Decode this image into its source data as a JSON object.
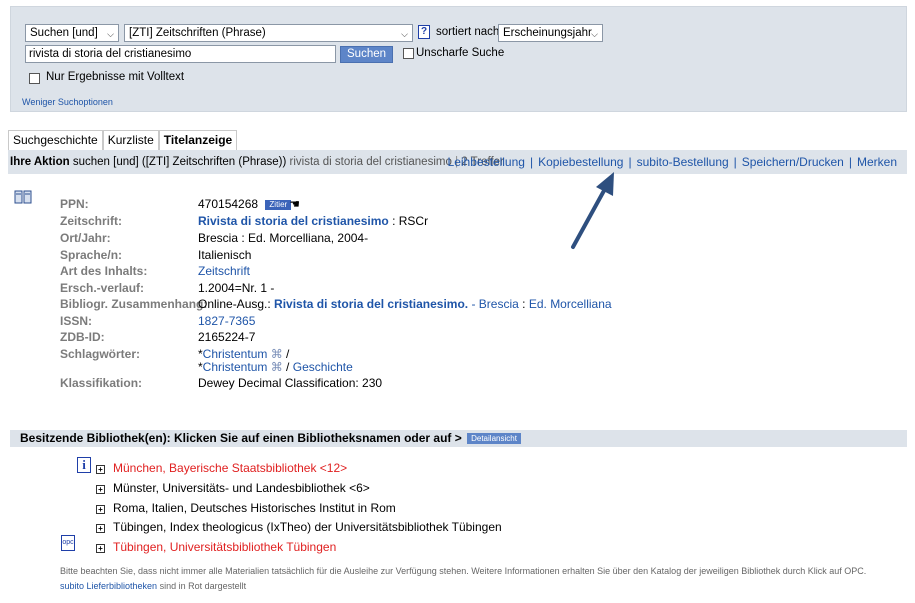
{
  "search": {
    "operator": "Suchen [und]",
    "field": "[ZTI] Zeitschriften (Phrase)",
    "help": "?",
    "sort_label": "sortiert nach",
    "sort_value": "Erscheinungsjahr",
    "query": "rivista di storia del cristianesimo",
    "submit": "Suchen",
    "fuzzy_label": "Unscharfe Suche",
    "fulltext_label": "Nur Ergebnisse mit Volltext",
    "fewer_options": "Weniger Suchoptionen"
  },
  "tabs": [
    {
      "label": "Suchgeschichte",
      "active": false
    },
    {
      "label": "Kurzliste",
      "active": false
    },
    {
      "label": "Titelanzeige",
      "active": true
    }
  ],
  "action_bar": {
    "title": "Ihre Aktion",
    "query_text": "suchen [und] ([ZTI] Zeitschriften (Phrase))",
    "query_value": "rivista di storia del cristianesimo",
    "hits": "2 Treffer",
    "links": [
      "Leihbestellung",
      "Kopiebestellung",
      "subito-Bestellung",
      "Speichern/Drucken",
      "Merken"
    ]
  },
  "record": {
    "ppn_label": "PPN:",
    "ppn": "470154268",
    "zitier": "Zitier",
    "zeitschrift_label": "Zeitschrift:",
    "zeitschrift_title": "Rivista di storia del cristianesimo",
    "zeitschrift_suffix": ": RSCr",
    "ort_label": "Ort/Jahr:",
    "ort": "Brescia : Ed. Morcelliana, 2004-",
    "sprache_label": "Sprache/n:",
    "sprache": "Italienisch",
    "art_label": "Art des Inhalts:",
    "art": "Zeitschrift",
    "ersch_label": "Ersch.-verlauf:",
    "ersch": "1.2004=Nr. 1 -",
    "bibl_label": "Bibliogr. Zusammenhang:",
    "bibl_prefix": "Online-Ausg.:",
    "bibl_title": "Rivista di storia del cristianesimo.",
    "bibl_place": "- Brescia",
    "bibl_sep": ":",
    "bibl_publisher": "Ed. Morcelliana",
    "issn_label": "ISSN:",
    "issn": "1827-7365",
    "zdb_label": "ZDB-ID:",
    "zdb": "2165224-7",
    "schlag_label": "Schlagwörter:",
    "schlag_1_star": "*",
    "schlag_1": "Christentum",
    "schlag_1_cmd": "⌘",
    "schlag_1_tail": "/",
    "schlag_2_star": "*",
    "schlag_2": "Christentum",
    "schlag_2_cmd": "⌘",
    "schlag_2_sep": "/",
    "schlag_2_b": "Geschichte",
    "klass_label": "Klassifikation:",
    "klass": "Dewey Decimal Classification: 230"
  },
  "holdings": {
    "header": "Besitzende Bibliothek(en): Klicken Sie auf einen Bibliotheksnamen oder auf >",
    "detail_button": "Detailansicht",
    "libraries": [
      {
        "name": "München, Bayerische Staatsbibliothek <12>",
        "red": true
      },
      {
        "name": "Münster, Universitäts- und Landesbibliothek <6>",
        "red": false
      },
      {
        "name": "Roma, Italien, Deutsches Historisches Institut in Rom",
        "red": false
      },
      {
        "name": "Tübingen, Index theologicus (IxTheo) der Universitätsbibliothek Tübingen",
        "red": false
      },
      {
        "name": "Tübingen, Universitätsbibliothek Tübingen",
        "red": true
      }
    ],
    "info_icon": "i",
    "opc_icon": "opc",
    "note_1": "Bitte beachten Sie, dass nicht immer alle Materialien tatsächlich für die Ausleihe zur Verfügung stehen. Weitere Informationen erhalten Sie über den Katalog der jeweiligen Bibliothek durch Klick auf OPC.",
    "note_2_link": "subito Lieferbibliotheken",
    "note_2_rest": " sind in Rot dargestellt"
  },
  "colors": {
    "panel": "#dde3ea",
    "link": "#1f55a8",
    "red": "#e02020",
    "arrow": "#2e4f7f"
  }
}
